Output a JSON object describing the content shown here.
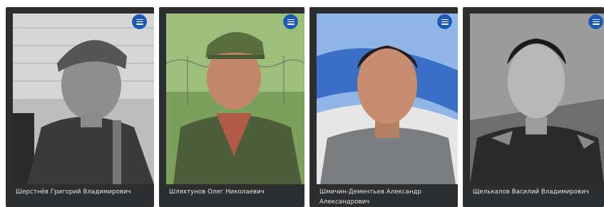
{
  "cards": [
    {
      "name": "Шерстнёв Григорий Владимирович",
      "menu_icon": "menu-icon"
    },
    {
      "name": "Шляхтунов Олег Николаевич",
      "menu_icon": "menu-icon"
    },
    {
      "name": "Шмичин-Дементьев Александр Александрович",
      "menu_icon": "menu-icon"
    },
    {
      "name": "Щелькалов Василий Владимирович",
      "menu_icon": "menu-icon"
    }
  ],
  "colors": {
    "card_bg": "#2c2e30",
    "menu_button": "#1e5ab4",
    "name_text": "#e8e8e8"
  }
}
